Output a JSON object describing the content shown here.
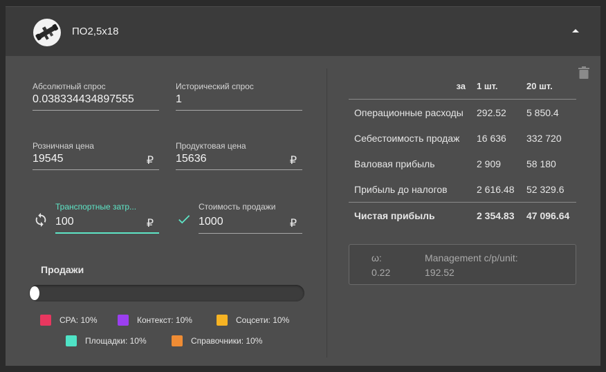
{
  "header": {
    "title": "ПО2,5х18",
    "avatar_icon": "rifle-scope-icon",
    "collapse_icon": "chevron-up-icon"
  },
  "fields": {
    "absolute_demand": {
      "label": "Абсолютный спрос",
      "value": "0.038334434897555"
    },
    "historical_demand": {
      "label": "Исторический спрос",
      "value": "1"
    },
    "retail_price": {
      "label": "Розничная цена",
      "value": "19545",
      "currency": "₽"
    },
    "product_price": {
      "label": "Продуктовая цена",
      "value": "15636",
      "currency": "₽"
    },
    "transport_costs": {
      "label": "Транспортные затр...",
      "value": "100",
      "currency": "₽",
      "icon": "sync-icon"
    },
    "sale_cost": {
      "label": "Стоимость продажи",
      "value": "1000",
      "currency": "₽",
      "icon": "check-icon"
    }
  },
  "sales": {
    "title": "Продажи",
    "slider_value": 0,
    "legend": [
      {
        "label": "CPA:",
        "value": "10%",
        "color": "#e8375f"
      },
      {
        "label": "Контекст:",
        "value": "10%",
        "color": "#9b3ff0"
      },
      {
        "label": "Соцсети:",
        "value": "10%",
        "color": "#f6b323"
      },
      {
        "label": "Площадки:",
        "value": "10%",
        "color": "#4fe3c6"
      },
      {
        "label": "Справочники:",
        "value": "10%",
        "color": "#ef8c34"
      }
    ]
  },
  "table": {
    "header": [
      "за",
      "1 шт.",
      "20 шт."
    ],
    "rows": [
      [
        "Операционные расходы",
        "292.52",
        "5 850.4"
      ],
      [
        "Себестоимость продаж",
        "16 636",
        "332 720"
      ],
      [
        "Валовая прибыль",
        "2 909",
        "58 180"
      ],
      [
        "Прибыль до налогов",
        "2 616.48",
        "52 329.6"
      ]
    ],
    "total": [
      "Чистая прибыль",
      "2 354.83",
      "47 096.64"
    ]
  },
  "info": {
    "omega_label": "ω:",
    "omega_value": "0.22",
    "management_label": "Management c/p/unit:",
    "management_value": "192.52"
  },
  "actions": {
    "delete_icon": "trash-icon"
  }
}
